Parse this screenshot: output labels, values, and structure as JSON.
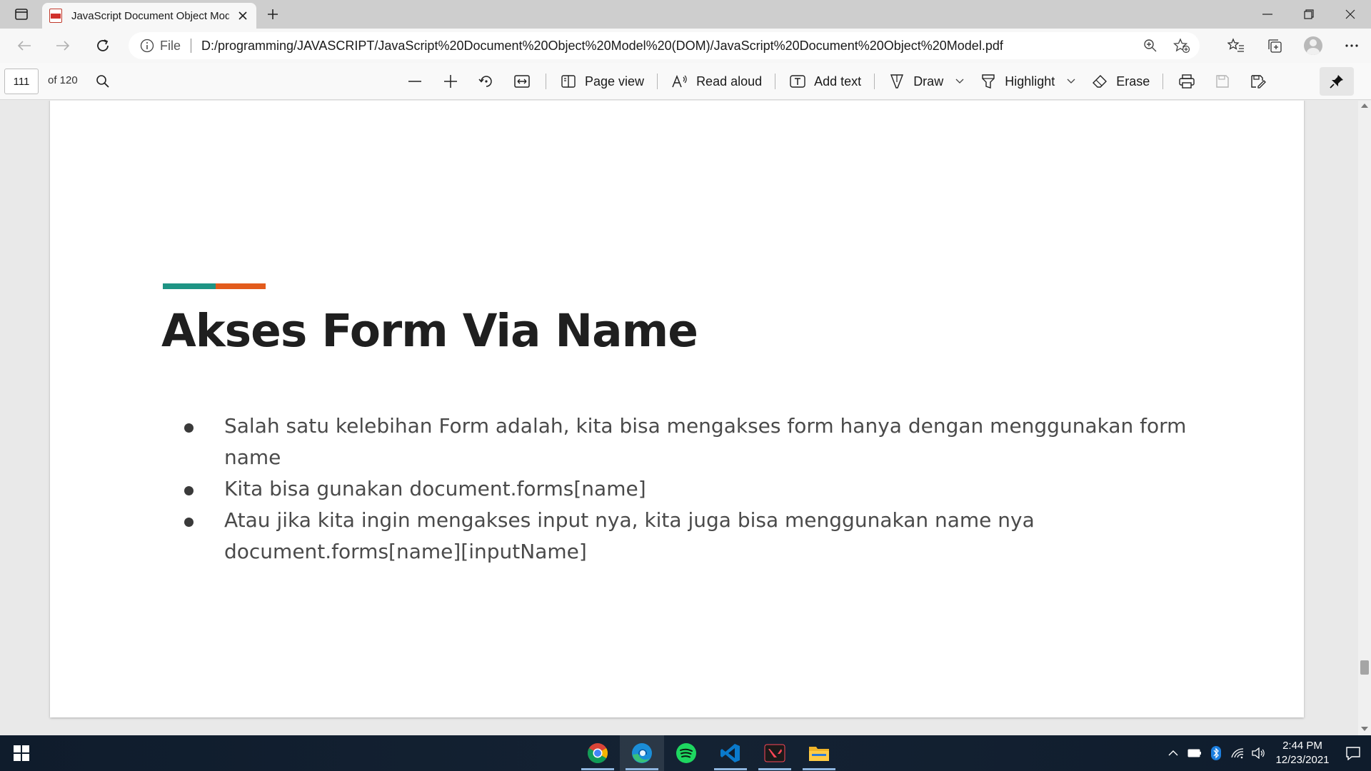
{
  "browser": {
    "tab": {
      "title": "JavaScript Document Object Model.pdf"
    },
    "address": {
      "scheme_label": "File",
      "url": "D:/programming/JAVASCRIPT/JavaScript%20Document%20Object%20Model%20(DOM)/JavaScript%20Document%20Object%20Model.pdf"
    }
  },
  "pdf_toolbar": {
    "page_number": "111",
    "page_count": "of 120",
    "page_view": "Page view",
    "read_aloud": "Read aloud",
    "add_text": "Add text",
    "draw": "Draw",
    "highlight": "Highlight",
    "erase": "Erase"
  },
  "slide": {
    "accent_colors": [
      "#1e9484",
      "#e25b1c"
    ],
    "title": "Akses Form Via Name",
    "bullets": [
      "Salah satu kelebihan Form adalah, kita bisa mengakses form hanya dengan menggunakan form name",
      "Kita bisa gunakan document.forms[name]",
      "Atau jika kita ingin mengakses input nya, kita juga bisa menggunakan name nya document.forms[name][inputName]"
    ]
  },
  "taskbar": {
    "apps": [
      "chrome-icon",
      "edge-icon",
      "spotify-icon",
      "vscode-icon",
      "valorant-icon",
      "file-explorer-icon"
    ],
    "time": "2:44 PM",
    "date": "12/23/2021"
  }
}
